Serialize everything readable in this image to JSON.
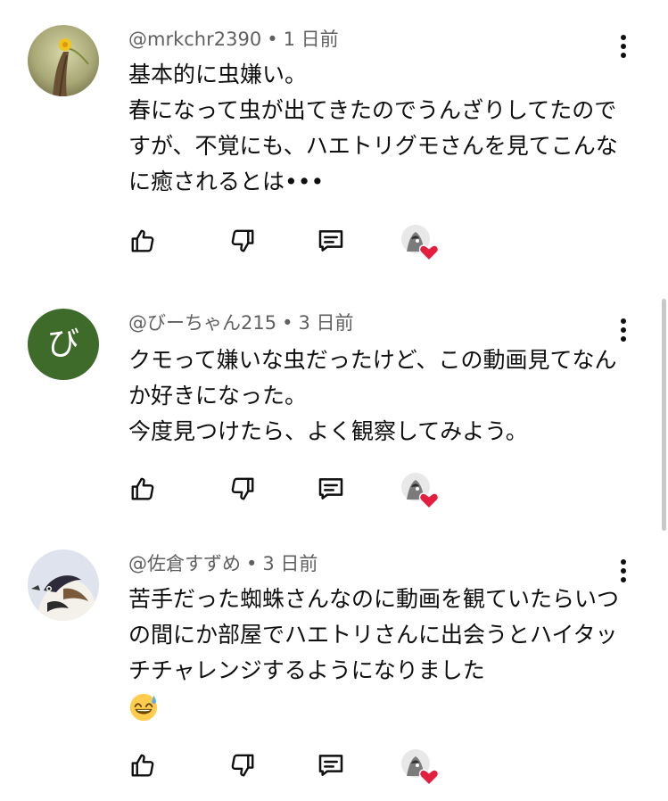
{
  "comments": [
    {
      "author": "@mrkchr2390",
      "time": "1 日前",
      "separator": "•",
      "text": "基本的に虫嫌い。\n春になって虫が出てきたのでうんざりしてたのですが、不覚にも、ハエトリグモさんを見てこんなに癒されるとは•••",
      "avatar": "flower-photo"
    },
    {
      "author": "@びーちゃん215",
      "time": "3 日前",
      "separator": "•",
      "text": "クモって嫌いな虫だったけど、この動画見てなんか好きになった。\n今度見つけたら、よく観察してみよう。",
      "avatar_letter": "び",
      "avatar_color": "#3f6b2a"
    },
    {
      "author": "@佐倉すずめ",
      "time": "3 日前",
      "separator": "•",
      "text": "苦手だった蜘蛛さんなのに動画を観ていたらいつの間にか部屋でハエトリさんに出会うとハイタッチチャレンジするようになりました",
      "emoji": "grinning-sweat-emoji",
      "avatar": "bird-illustration"
    }
  ],
  "icons": {
    "like": "thumbs-up-icon",
    "dislike": "thumbs-down-icon",
    "reply": "reply-icon",
    "creator_heart": "creator-heart-icon",
    "menu": "more-vertical-icon"
  },
  "colors": {
    "heart": "#e41e3f",
    "meta_text": "#606060"
  }
}
